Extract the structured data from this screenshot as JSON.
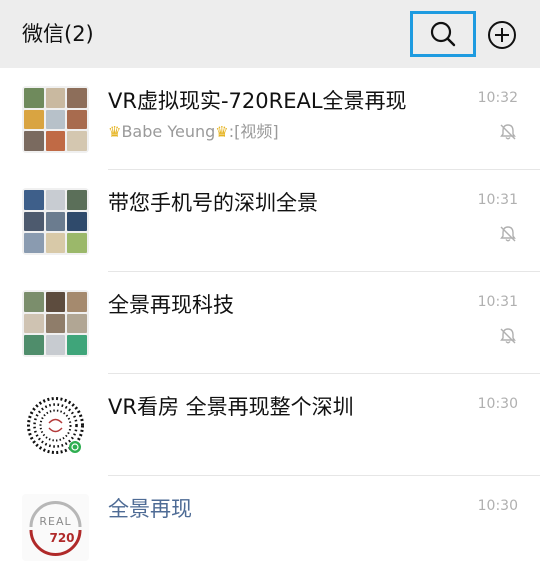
{
  "header": {
    "title": "微信(2)",
    "search_icon": "search-icon",
    "add_icon": "plus-circle-icon"
  },
  "chats": [
    {
      "name": "VR虚拟现实-720REAL全景再现",
      "preview_sender": "Babe Yeung",
      "preview_sep": ":",
      "preview_text": "[视频]",
      "time": "10:32",
      "muted": true
    },
    {
      "name": "带您手机号的深圳全景",
      "time": "10:31",
      "muted": true
    },
    {
      "name": "全景再现科技",
      "time": "10:31",
      "muted": true
    },
    {
      "name": "VR看房  全景再现整个深圳",
      "time": "10:30",
      "muted": false
    },
    {
      "name": "全景再现",
      "time": "10:30",
      "muted": false
    }
  ],
  "logo": {
    "text_top": "REAL",
    "text_bottom": "720"
  },
  "colors": {
    "header_bg": "#ededed",
    "highlight": "#1e9be0",
    "official_account_name": "#4e6b95",
    "crown": "#e6b422"
  }
}
